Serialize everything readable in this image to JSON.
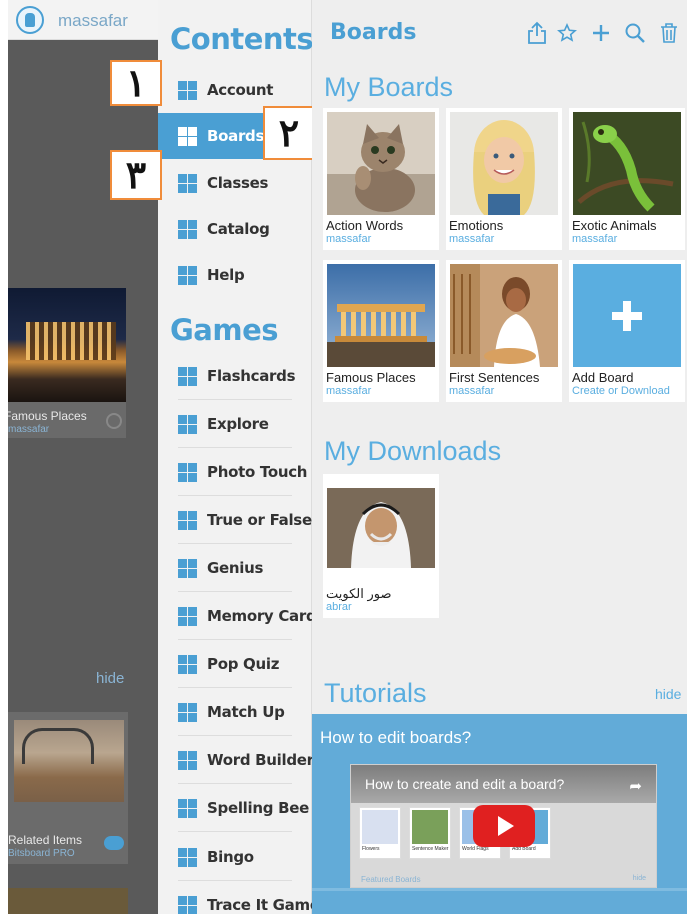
{
  "background_app": {
    "username": "massafar",
    "tile": {
      "title": "Famous Places",
      "subtitle": "massafar"
    },
    "hide_label": "hide",
    "related": {
      "title": "Related Items",
      "subtitle": "Bitsboard PRO"
    }
  },
  "menu": {
    "contents_heading": "Contents",
    "contents_items": [
      {
        "label": "Account"
      },
      {
        "label": "Boards",
        "active": true
      },
      {
        "label": "Classes"
      },
      {
        "label": "Catalog"
      },
      {
        "label": "Help"
      }
    ],
    "games_heading": "Games",
    "games_items": [
      {
        "label": "Flashcards"
      },
      {
        "label": "Explore"
      },
      {
        "label": "Photo Touch"
      },
      {
        "label": "True or False"
      },
      {
        "label": "Genius"
      },
      {
        "label": "Memory Cards"
      },
      {
        "label": "Pop Quiz"
      },
      {
        "label": "Match Up"
      },
      {
        "label": "Word Builder"
      },
      {
        "label": "Spelling Bee"
      },
      {
        "label": "Bingo"
      },
      {
        "label": "Trace It Game"
      }
    ]
  },
  "annotations": [
    "١",
    "٢",
    "٣"
  ],
  "boards": {
    "title": "Boards",
    "toolbar_icons": [
      "share-icon",
      "star-icon",
      "plus-icon",
      "search-icon",
      "trash-icon"
    ],
    "my_boards_heading": "My Boards",
    "my_boards": [
      {
        "title": "Action Words",
        "subtitle": "massafar",
        "image": "cat-photo"
      },
      {
        "title": "Emotions",
        "subtitle": "massafar",
        "image": "girl-photo"
      },
      {
        "title": "Exotic Animals",
        "subtitle": "massafar",
        "image": "chameleon-photo"
      },
      {
        "title": "Famous Places",
        "subtitle": "massafar",
        "image": "parthenon-photo"
      },
      {
        "title": "First Sentences",
        "subtitle": "massafar",
        "image": "bakery-photo"
      },
      {
        "title": "Add Board",
        "subtitle": "Create or Download",
        "image": "plus-icon"
      }
    ],
    "my_downloads_heading": "My Downloads",
    "my_downloads": [
      {
        "title": "صور الكويت",
        "subtitle": "abrar",
        "image": "man-portrait-photo"
      }
    ],
    "tutorials_heading": "Tutorials",
    "tutorials_hide": "hide",
    "tutorial": {
      "heading": "How to edit boards?",
      "video_title": "How to create and edit a board?",
      "mini_tiles": [
        "Flowers",
        "Sentence Maker",
        "World Flags",
        "Add Board"
      ],
      "footer_left": "Featured Boards",
      "footer_right": "hide"
    }
  },
  "colors": {
    "accent": "#4a9fd3",
    "annotation_border": "#f08c3a",
    "tutorial_panel": "#62abd8"
  }
}
